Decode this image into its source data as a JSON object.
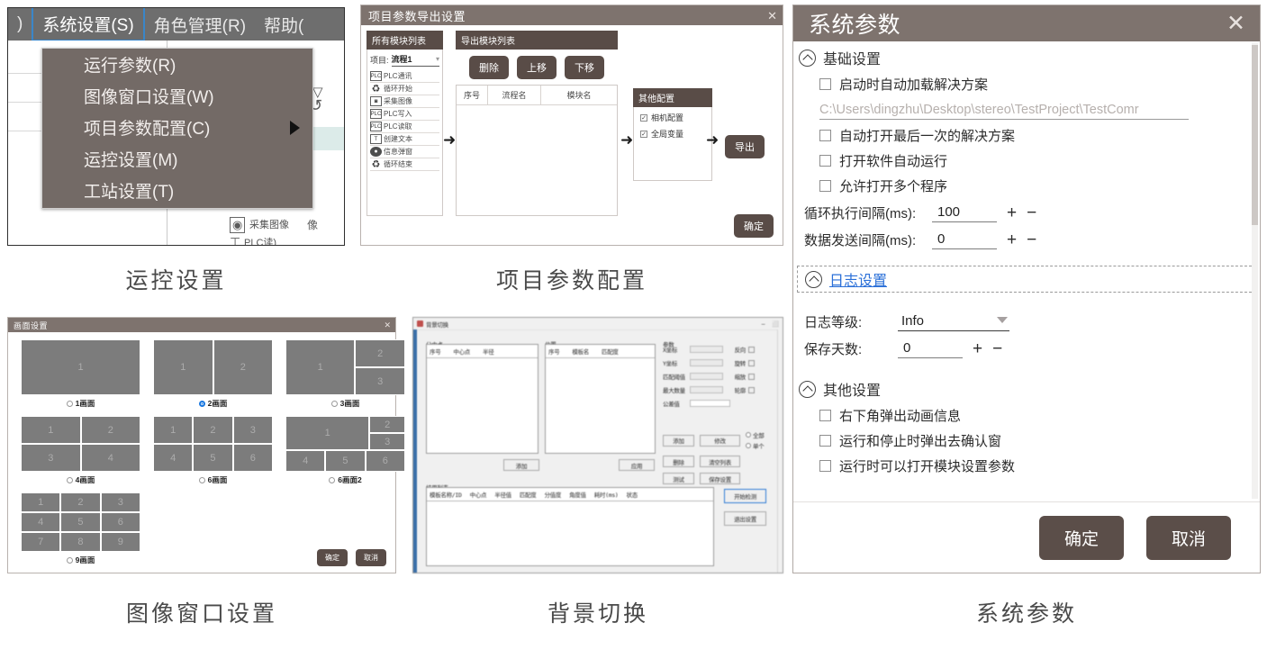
{
  "figures": [
    {
      "caption": "运控设置"
    },
    {
      "caption": "项目参数配置"
    },
    {
      "caption": "图像窗口设置"
    },
    {
      "caption": "背景切换"
    },
    {
      "caption": "系统参数"
    }
  ],
  "menu_panel": {
    "menubar": [
      {
        "label": ")",
        "active": false
      },
      {
        "label": "系统设置(S)",
        "active": true
      },
      {
        "label": "角色管理(R)",
        "active": false
      },
      {
        "label": "帮助(",
        "active": false
      }
    ],
    "items": [
      {
        "label": "运行参数(R)",
        "submenu": false
      },
      {
        "label": "图像窗口设置(W)",
        "submenu": false
      },
      {
        "label": "项目参数配置(C)",
        "submenu": true
      },
      {
        "label": "运控设置(M)",
        "submenu": false
      },
      {
        "label": "工站设置(T)",
        "submenu": false
      }
    ]
  },
  "export_dialog": {
    "title": "项目参数导出设置",
    "close": "✕",
    "all_modules": {
      "header": "所有模块列表",
      "project_label": "项目:",
      "project_value": "流程1",
      "caret": "▾",
      "modules": [
        {
          "icon": "plc-icon",
          "glyph": "PLC",
          "label": "PLC通讯"
        },
        {
          "icon": "loop-start-icon",
          "glyph": "♻",
          "label": "循环开始"
        },
        {
          "icon": "camera-icon",
          "glyph": "◙",
          "label": "采集图像"
        },
        {
          "icon": "plc-write-icon",
          "glyph": "PLC",
          "label": "PLC写入"
        },
        {
          "icon": "plc-read-icon",
          "glyph": "PLC",
          "label": "PLC读取"
        },
        {
          "icon": "text-icon",
          "glyph": "T",
          "label": "创建文本"
        },
        {
          "icon": "message-icon",
          "glyph": "●",
          "label": "信息弹窗"
        },
        {
          "icon": "loop-end-icon",
          "glyph": "♻",
          "label": "循环结束"
        }
      ]
    },
    "export_modules": {
      "header": "导出模块列表",
      "buttons": [
        "删除",
        "上移",
        "下移"
      ],
      "columns": [
        "序号",
        "流程名",
        "模块名"
      ],
      "rows": []
    },
    "other_config": {
      "header": "其他配置",
      "checks": [
        {
          "label": "相机配置",
          "checked": true
        },
        {
          "label": "全局变量",
          "checked": true
        }
      ]
    },
    "export_button": "导出",
    "ok_button": "确定",
    "arrow": "➜"
  },
  "screen_dialog": {
    "title": "画面设置",
    "close": "✕",
    "layouts": [
      {
        "name": "1画面",
        "selected": false
      },
      {
        "name": "2画面",
        "selected": true
      },
      {
        "name": "3画面",
        "selected": false
      },
      {
        "name": "4画面",
        "selected": false
      },
      {
        "name": "6画面",
        "selected": false
      },
      {
        "name": "6画面2",
        "selected": false
      },
      {
        "name": "9画面",
        "selected": false
      }
    ],
    "ok_button": "确定",
    "cancel_button": "取消"
  },
  "background_dialog": {
    "title_blurred": "背景切换",
    "minimize": "–",
    "maximize": "⬜",
    "group_labels": [
      "分中点",
      "位置",
      "参数"
    ],
    "left_columns": [
      "序号",
      "中心点",
      "半径"
    ],
    "mid_columns": [
      "序号",
      "模板名",
      "匹配度"
    ],
    "bottom_label": "结果列表",
    "bottom_columns": [
      "模板名称/ID",
      "中心点",
      "半径值",
      "匹配度",
      "分值度",
      "角度值",
      "耗时(ms)",
      "状态"
    ],
    "right_fields": [
      "X坐标",
      "Y坐标",
      "匹配阈值",
      "最大数量",
      "公差值"
    ],
    "right_checks": [
      "反向",
      "旋转",
      "缩放",
      "轮廓"
    ],
    "right_buttons": [
      "添加",
      "修改",
      "删除",
      "清空列表",
      "测试",
      "保存设置"
    ],
    "radio_options": [
      "全部",
      "单个"
    ],
    "left_button": "添加",
    "mid_button": "应用",
    "action_buttons": [
      "开始检测",
      "退出设置"
    ]
  },
  "sysparam_dialog": {
    "title": "系统参数",
    "close": "✕",
    "groups": [
      {
        "name": "基础设置",
        "link": false,
        "checks": [
          {
            "label": "启动时自动加载解决方案",
            "checked": false
          },
          {
            "label": "自动打开最后一次的解决方案",
            "checked": false
          },
          {
            "label": "打开软件自动运行",
            "checked": false
          },
          {
            "label": "允许打开多个程序",
            "checked": false
          }
        ],
        "path_placeholder": "C:\\Users\\dingzhu\\Desktop\\stereo\\TestProject\\TestComr",
        "numbers": [
          {
            "label": "循环执行间隔(ms):",
            "value": "100",
            "plus": "+",
            "minus": "−"
          },
          {
            "label": "数据发送间隔(ms):",
            "value": "0",
            "plus": "+",
            "minus": "−"
          }
        ]
      },
      {
        "name": "日志设置",
        "link": true,
        "select": {
          "label": "日志等级:",
          "value": "Info"
        },
        "numbers": [
          {
            "label": "保存天数:",
            "value": "0",
            "plus": "+",
            "minus": "−"
          }
        ]
      },
      {
        "name": "其他设置",
        "link": false,
        "checks": [
          {
            "label": "右下角弹出动画信息",
            "checked": false
          },
          {
            "label": "运行和停止时弹出去确认窗",
            "checked": false
          },
          {
            "label": "运行时可以打开模块设置参数",
            "checked": false
          }
        ]
      }
    ],
    "ok_button": "确定",
    "cancel_button": "取消"
  },
  "colors": {
    "title_bar": "#7e736e",
    "button_dark": "#594c47",
    "accent_blue": "#1877e0",
    "link_blue": "#2a6fd8",
    "cell_gray": "#7c7c7c",
    "menu_bg": "#736a66"
  }
}
